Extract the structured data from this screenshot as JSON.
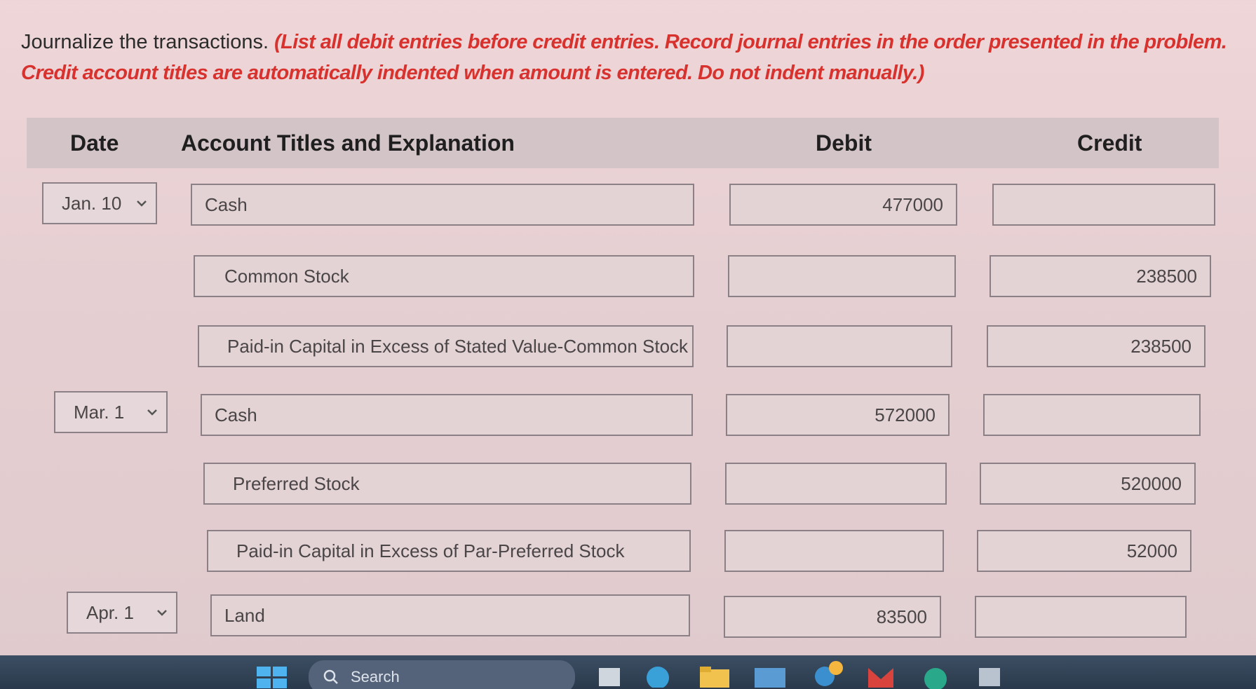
{
  "instructions": {
    "prefix": "Journalize the transactions. ",
    "note": "(List all debit entries before credit entries. Record journal entries in the order presented in the problem. Credit account titles are automatically indented when amount is entered. Do not indent manually.)"
  },
  "header": {
    "date": "Date",
    "account": "Account Titles and Explanation",
    "debit": "Debit",
    "credit": "Credit"
  },
  "rows": [
    {
      "date": "Jan. 10",
      "account": "Cash",
      "debit": "477000",
      "credit": ""
    },
    {
      "date": "",
      "account": "Common Stock",
      "debit": "",
      "credit": "238500"
    },
    {
      "date": "",
      "account": "Paid-in Capital in Excess of Stated Value-Common Stock",
      "debit": "",
      "credit": "238500"
    },
    {
      "date": "Mar. 1",
      "account": "Cash",
      "debit": "572000",
      "credit": ""
    },
    {
      "date": "",
      "account": "Preferred Stock",
      "debit": "",
      "credit": "520000"
    },
    {
      "date": "",
      "account": "Paid-in Capital in Excess of Par-Preferred Stock",
      "debit": "",
      "credit": "52000"
    },
    {
      "date": "Apr. 1",
      "account": "Land",
      "debit": "83500",
      "credit": ""
    }
  ],
  "taskbar": {
    "search_label": "Search"
  },
  "colors": {
    "note_red": "#d8322f",
    "taskbar": "#2f3f52"
  }
}
